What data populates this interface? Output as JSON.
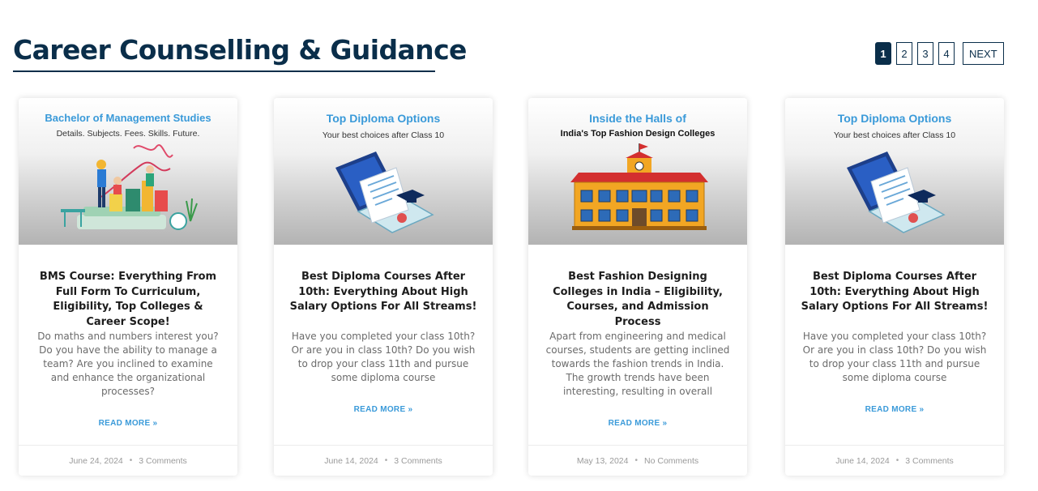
{
  "section": {
    "title": "Career Counselling & Guidance"
  },
  "pagination": {
    "pages": [
      "1",
      "2",
      "3",
      "4"
    ],
    "current": "1",
    "next_label": "NEXT"
  },
  "cards": [
    {
      "thumb_title": "Bachelor of Management Studies",
      "thumb_subtitle": "Details. Subjects. Fees. Skills. Future.",
      "thumb_icon": "team-business-illustration-icon",
      "title": "BMS Course: Everything From Full Form To Curriculum, Eligibility, Top Colleges & Career Scope!",
      "excerpt": "Do maths and numbers interest you? Do you have the ability to manage a team? Are you inclined to examine and enhance the organizational processes?",
      "read_more": "READ MORE »",
      "date": "June 24, 2024",
      "separator": "•",
      "comments": "3 Comments"
    },
    {
      "thumb_title": "Top Diploma Options",
      "thumb_subtitle": "Your best choices after Class 10",
      "thumb_icon": "laptop-diploma-icon",
      "title": "Best Diploma Courses After 10th: Everything About High Salary Options For All Streams!",
      "excerpt": "Have you completed your class 10th? Or are you in class 10th? Do you wish to drop your class 11th and pursue some diploma course",
      "read_more": "READ MORE »",
      "date": "June 14, 2024",
      "separator": "•",
      "comments": "3 Comments"
    },
    {
      "thumb_title": "Inside the Halls of",
      "thumb_subtitle": "India's Top Fashion Design Colleges",
      "thumb_icon": "college-building-icon",
      "title": "Best Fashion Designing Colleges in India – Eligibility, Courses, and Admission Process",
      "excerpt": "Apart from engineering and medical courses, students are getting inclined towards the fashion trends in India. The growth trends have been interesting, resulting in overall",
      "read_more": "READ MORE »",
      "date": "May 13, 2024",
      "separator": "•",
      "comments": "No Comments"
    },
    {
      "thumb_title": "Top Diploma Options",
      "thumb_subtitle": "Your best choices after Class 10",
      "thumb_icon": "laptop-diploma-icon",
      "title": "Best Diploma Courses After 10th: Everything About High Salary Options For All Streams!",
      "excerpt": "Have you completed your class 10th? Or are you in class 10th? Do you wish to drop your class 11th and pursue some diploma course",
      "read_more": "READ MORE »",
      "date": "June 14, 2024",
      "separator": "•",
      "comments": "3 Comments"
    }
  ],
  "colors": {
    "heading": "#0a2e4a",
    "accent": "#3a9ad9",
    "muted": "#9a9a9a"
  }
}
